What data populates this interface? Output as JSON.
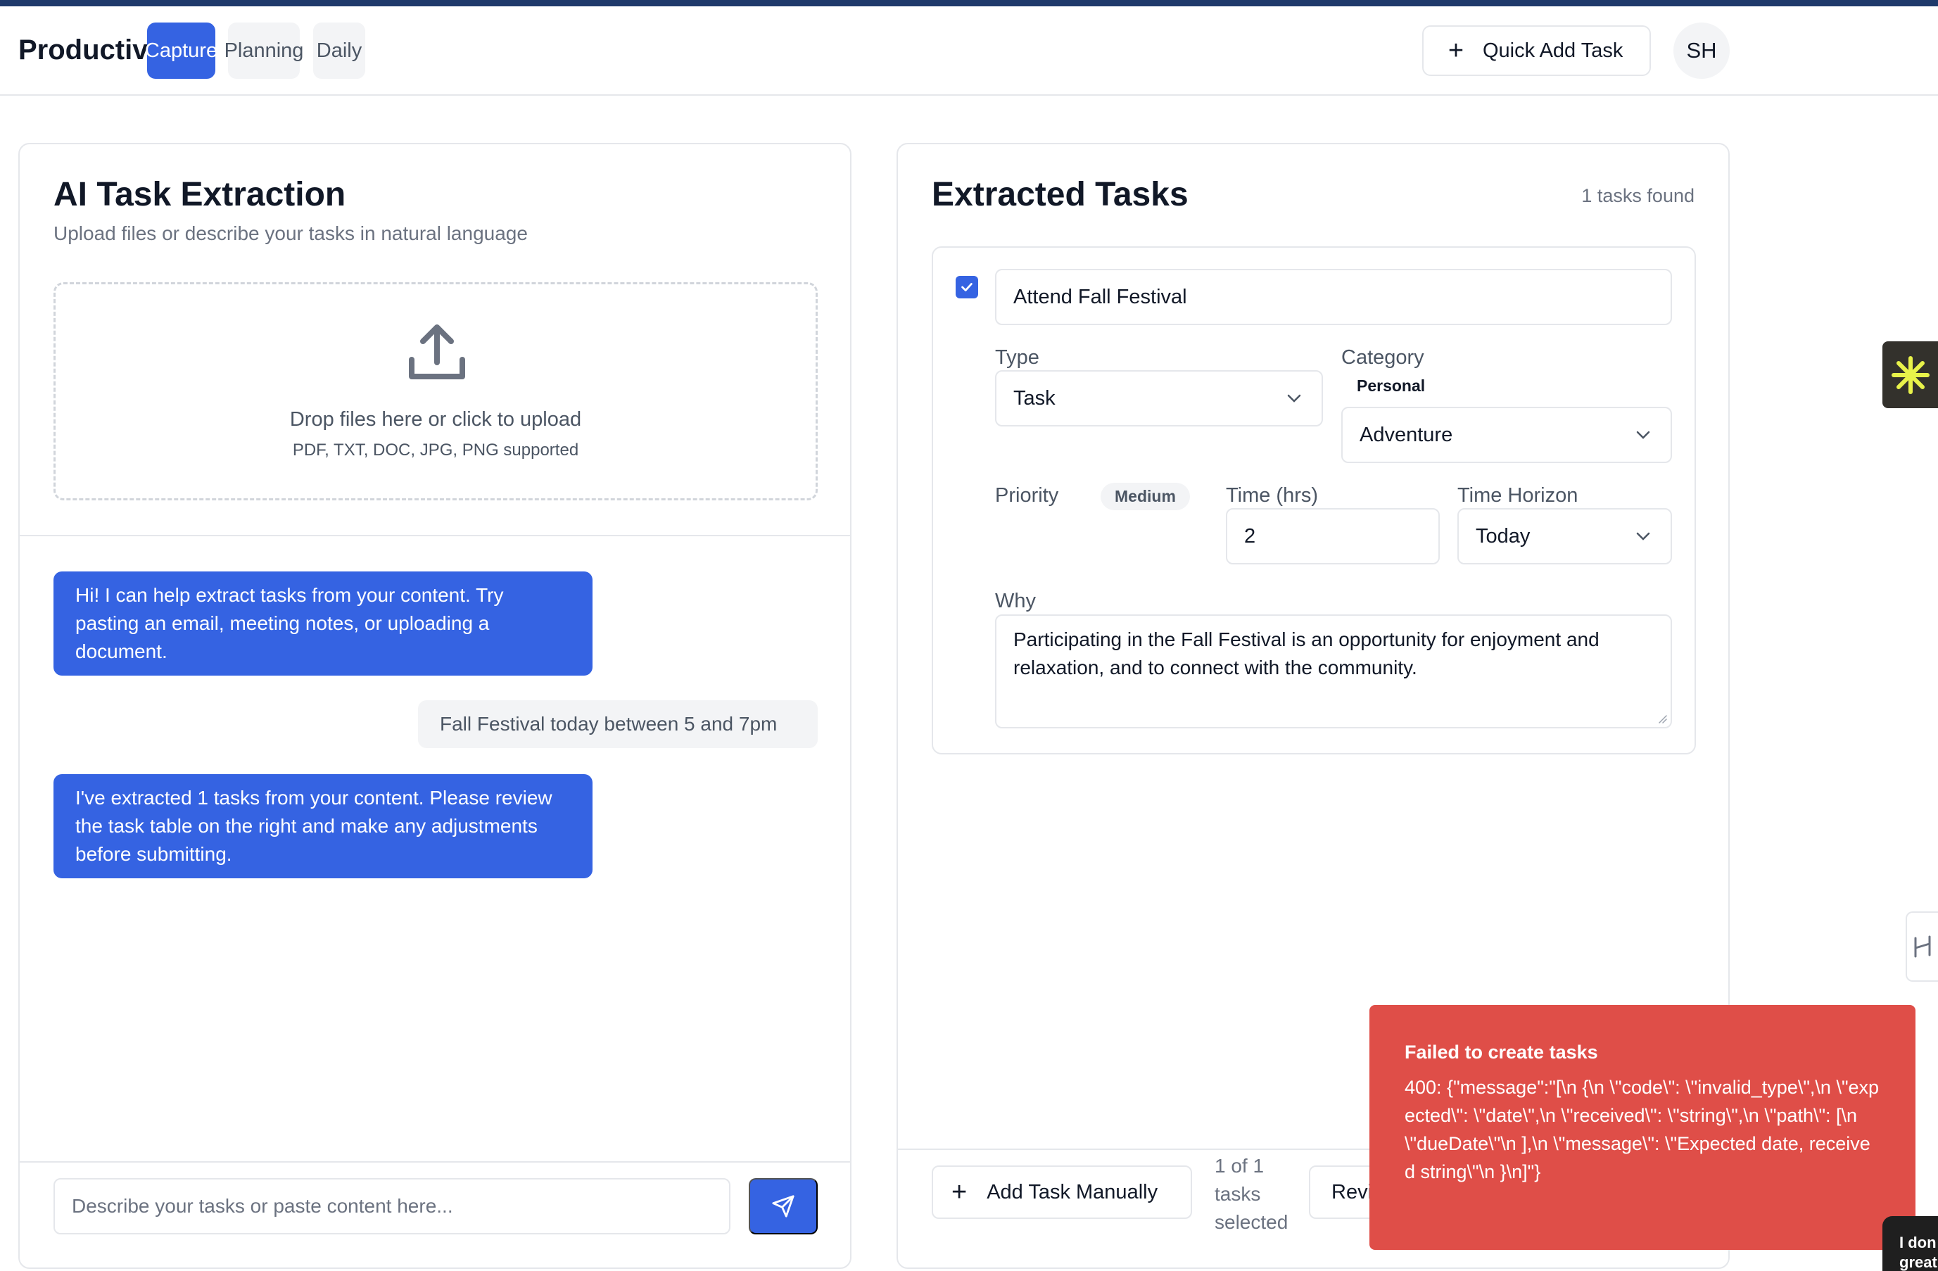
{
  "app": {
    "brand": "ProductivityAI",
    "nav_tabs": [
      {
        "label": "Capture",
        "active": true
      },
      {
        "label": "Planning",
        "active": false
      },
      {
        "label": "Daily",
        "active": false
      }
    ],
    "quick_add_label": "Quick Add Task",
    "avatar_initials": "SH",
    "accent_color": "#3563e2"
  },
  "left_panel": {
    "title": "AI Task Extraction",
    "subtitle": "Upload files or describe your tasks in natural language",
    "dropzone": {
      "main_text": "Drop files here or click to upload",
      "sub_text": "PDF, TXT, DOC, JPG, PNG supported"
    },
    "messages": [
      {
        "role": "ai",
        "text": "Hi! I can help extract tasks from your content. Try pasting an email, meeting notes, or uploading a document."
      },
      {
        "role": "user",
        "text": "Fall Festival today between 5 and 7pm"
      },
      {
        "role": "ai",
        "text": "I've extracted 1 tasks from your content. Please review the task table on the right and make any adjustments before submitting."
      }
    ],
    "input_placeholder": "Describe your tasks or paste content here..."
  },
  "right_panel": {
    "title": "Extracted Tasks",
    "count_text": "1 tasks found",
    "task": {
      "checked": true,
      "title": "Attend Fall Festival",
      "type_label": "Type",
      "type_value": "Task",
      "category_label": "Category",
      "category_badge": "Personal",
      "category_value": "Adventure",
      "priority_label": "Priority",
      "priority_value": "Medium",
      "time_label": "Time (hrs)",
      "time_value": "2",
      "horizon_label": "Time Horizon",
      "horizon_value": "Today",
      "why_label": "Why",
      "why_value": "Participating in the Fall Festival is an opportunity for enjoyment and relaxation, and to connect with the community."
    },
    "footer": {
      "add_manual_label": "Add Task Manually",
      "selected_text": "1 of 1 tasks selected",
      "review_label": "Revi"
    }
  },
  "toast": {
    "title": "Failed to create tasks",
    "body": "400: {\"message\":\"[\\n {\\n \\\"code\\\": \\\"invalid_type\\\",\\n \\\"expected\\\": \\\"date\\\",\\n \\\"received\\\": \\\"string\\\",\\n \\\"path\\\": [\\n \\\"dueDate\\\"\\n ],\\n \\\"message\\\": \\\"Expected date, received string\\\"\\n }\\n]\"}",
    "color": "#df4e48"
  },
  "corner_widget": {
    "text_line1": "I don",
    "text_line2": "great"
  }
}
